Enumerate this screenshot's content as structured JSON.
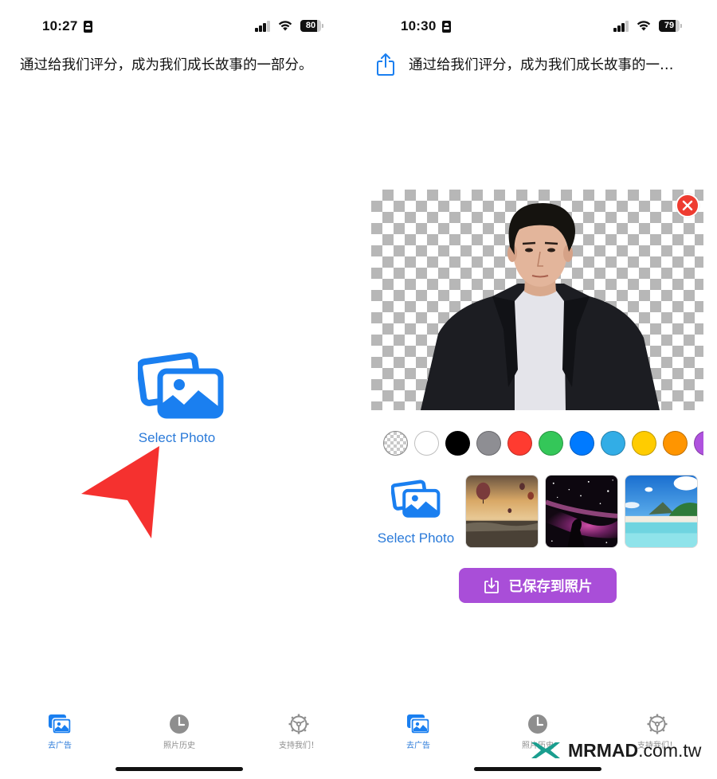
{
  "left_screen": {
    "status_bar": {
      "time": "10:27",
      "battery": "80"
    },
    "header_text": "通过给我们评分，成为我们成长故事的一部分。",
    "select_photo_label": "Select Photo",
    "tab_bar": {
      "tabs": [
        {
          "label": "去广告",
          "icon": "photos-icon",
          "active": true
        },
        {
          "label": "照片历史",
          "icon": "clock-icon",
          "active": false
        },
        {
          "label": "支持我们！",
          "icon": "gear-icon",
          "active": false
        }
      ]
    }
  },
  "right_screen": {
    "status_bar": {
      "time": "10:30",
      "battery": "79"
    },
    "header_text": "通过给我们评分，成为我们成长故事的一…",
    "editor": {
      "close_icon": "close-icon",
      "color_swatches": [
        {
          "name": "transparent",
          "color": "transparent"
        },
        {
          "name": "white",
          "color": "#ffffff"
        },
        {
          "name": "black",
          "color": "#000000"
        },
        {
          "name": "gray",
          "color": "#8e8e93"
        },
        {
          "name": "red",
          "color": "#ff3b30"
        },
        {
          "name": "green",
          "color": "#34c759"
        },
        {
          "name": "blue",
          "color": "#007aff"
        },
        {
          "name": "light-blue",
          "color": "#32ade6"
        },
        {
          "name": "yellow",
          "color": "#ffcc00"
        },
        {
          "name": "orange",
          "color": "#ff9500"
        },
        {
          "name": "purple",
          "color": "#af52de"
        }
      ],
      "select_photo_label": "Select Photo",
      "backgrounds": [
        {
          "name": "hot-air-balloons"
        },
        {
          "name": "nebula"
        },
        {
          "name": "tropical-beach"
        }
      ],
      "save_button_label": "已保存到照片"
    },
    "tab_bar": {
      "tabs": [
        {
          "label": "去广告",
          "icon": "photos-icon",
          "active": true
        },
        {
          "label": "照片历史",
          "icon": "clock-icon",
          "active": false
        },
        {
          "label": "支持我们！",
          "icon": "gear-icon",
          "active": false
        }
      ]
    }
  },
  "watermark": {
    "brand": "MRMAD",
    "domain": ".com.tw"
  },
  "colors": {
    "accent_blue": "#2a7ad9",
    "save_purple": "#a94ed8",
    "close_red": "#ee3b30",
    "annotation_arrow": "#f5312f",
    "tab_inactive": "#8e8e8e",
    "watermark_teal": "#1a9e8f"
  }
}
